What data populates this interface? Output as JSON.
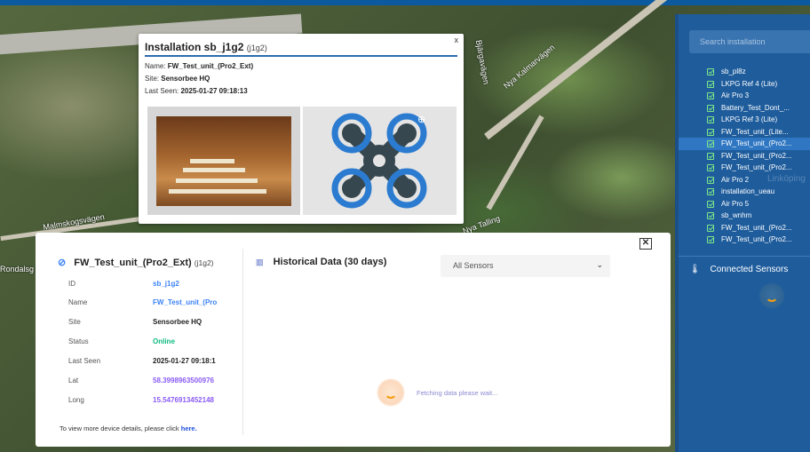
{
  "map": {
    "labels": [
      "Nya Kalmarvägen",
      "Malmskogsvägen",
      "Rondalsg",
      "Bjärgavägen",
      "Nya Talling"
    ]
  },
  "popup": {
    "title": "Installation sb_j1g2",
    "title_sub": "(j1g2)",
    "close_label": "x",
    "name_label": "Name:",
    "name_value": "FW_Test_unit_(Pro2_Ext)",
    "site_label": "Site:",
    "site_value": "Sensorbee HQ",
    "last_seen_label": "Last Seen:",
    "last_seen_value": "2025-01-27 09:18:13"
  },
  "device": {
    "title": "FW_Test_unit_(Pro2_Ext)",
    "title_sub": "(j1g2)",
    "close_label": "✕",
    "fields": [
      {
        "label": "ID",
        "value": "sb_j1g2"
      },
      {
        "label": "Name",
        "value": "FW_Test_unit_(Pro"
      },
      {
        "label": "Site",
        "value": "Sensorbee HQ"
      },
      {
        "label": "Status",
        "value": "Online"
      },
      {
        "label": "Last Seen",
        "value": "2025-01-27 09:18:1"
      },
      {
        "label": "Lat",
        "value": "58.3998963500976"
      },
      {
        "label": "Long",
        "value": "15.5476913452148"
      }
    ],
    "more_text": "To view more device details, please click",
    "more_link": "here."
  },
  "history": {
    "title": "Historical Data (30 days)",
    "select_value": "All Sensors",
    "loading_text": "Fetching data please wait..."
  },
  "sidebar": {
    "search_placeholder": "Search installation",
    "items": [
      {
        "label": "sb_pl8z",
        "selected": false
      },
      {
        "label": "LKPG Ref 4 (Lite)",
        "selected": false
      },
      {
        "label": "Air Pro 3",
        "selected": false
      },
      {
        "label": "Battery_Test_Dont_...",
        "selected": false
      },
      {
        "label": "LKPG Ref 3 (Lite)",
        "selected": false
      },
      {
        "label": "FW_Test_unit_(Lite...",
        "selected": false
      },
      {
        "label": "FW_Test_unit_(Pro2...",
        "selected": true
      },
      {
        "label": "FW_Test_unit_(Pro2...",
        "selected": false
      },
      {
        "label": "FW_Test_unit_(Pro2...",
        "selected": false
      },
      {
        "label": "Air Pro 2",
        "selected": false
      },
      {
        "label": "installation_ueau",
        "selected": false
      },
      {
        "label": "Air Pro 5",
        "selected": false
      },
      {
        "label": "sb_wnhm",
        "selected": false
      },
      {
        "label": "FW_Test_unit_(Pro2...",
        "selected": false
      },
      {
        "label": "FW_Test_unit_(Pro2...",
        "selected": false
      }
    ],
    "connected_label": "Connected Sensors",
    "ghost_label": "Linköping"
  },
  "colors": {
    "accent": "#3b82f6",
    "online": "#10b981",
    "coord": "#8b5cf6",
    "sidebar": "#1e5c9c"
  }
}
